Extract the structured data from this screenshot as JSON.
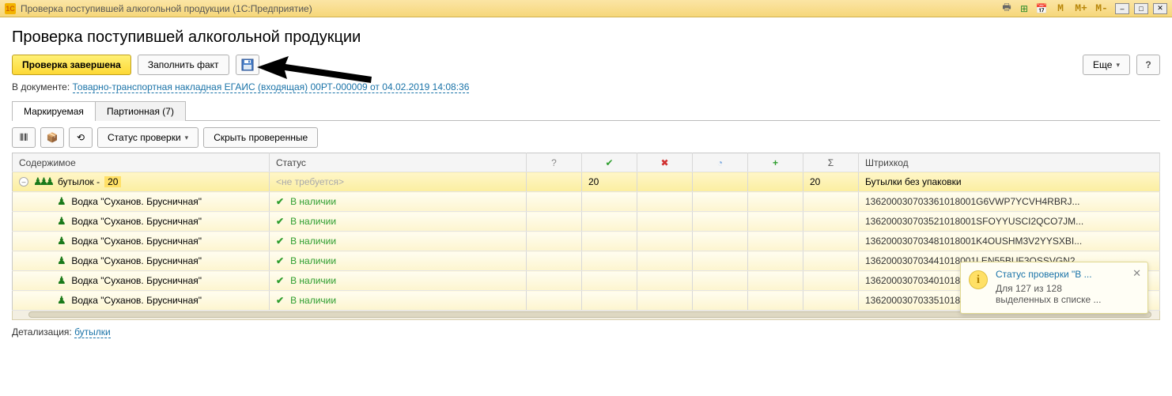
{
  "titlebar": {
    "app_icon_text": "1C",
    "text": "Проверка поступившей алкогольной продукции  (1С:Предприятие)",
    "m1": "M",
    "m2": "M+",
    "m3": "M-"
  },
  "page_title": "Проверка поступившей алкогольной продукции",
  "toolbar": {
    "done_label": "Проверка завершена",
    "fill_fact_label": "Заполнить факт",
    "more_label": "Еще",
    "help_label": "?"
  },
  "doc_line": {
    "prefix": "В документе:  ",
    "link_text": "Товарно-транспортная накладная ЕГАИС (входящая) 00РТ-000009 от 04.02.2019 14:08:36"
  },
  "tabs": {
    "markable": "Маркируемая",
    "batch": "Партионная (7)"
  },
  "toolbar2": {
    "status_label": "Статус проверки",
    "hide_checked_label": "Скрыть проверенные"
  },
  "columns": {
    "contents": "Содержимое",
    "status": "Статус",
    "question": "?",
    "check": "✔",
    "cross": "✖",
    "clock": "◔",
    "plus": "+",
    "sigma": "Σ",
    "barcode": "Штрихкод"
  },
  "group_row": {
    "label": "бутылок  -",
    "count": "20",
    "status": "<не требуется>",
    "col_check": "20",
    "col_sigma": "20",
    "barcode": "Бутылки без упаковки"
  },
  "rows": [
    {
      "name": "Водка \"Суханов. Брусничная\"",
      "status": "В наличии",
      "barcode": "136200030703361018001G6VWP7YCVH4RBRJ..."
    },
    {
      "name": "Водка \"Суханов. Брусничная\"",
      "status": "В наличии",
      "barcode": "136200030703521018001SFOYYUSCI2QCO7JM..."
    },
    {
      "name": "Водка \"Суханов. Брусничная\"",
      "status": "В наличии",
      "barcode": "136200030703481018001K4OUSHM3V2YYSXBI..."
    },
    {
      "name": "Водка \"Суханов. Брусничная\"",
      "status": "В наличии",
      "barcode": "136200030703441018001LEN55BUF3QSSVGN2..."
    },
    {
      "name": "Водка \"Суханов. Брусничная\"",
      "status": "В наличии",
      "barcode": "136200030703401018001PO2INVVF2ZNUYZO2..."
    },
    {
      "name": "Водка \"Суханов. Брусничная\"",
      "status": "В наличии",
      "barcode": "136200030703351018000123E4RNKSMZ7AKUP..."
    }
  ],
  "detail": {
    "prefix": "Детализация:  ",
    "link": "бутылки"
  },
  "toast": {
    "title": "Статус проверки \"В ...",
    "line1": "Для 127 из 128",
    "line2": "выделенных в списке ..."
  }
}
